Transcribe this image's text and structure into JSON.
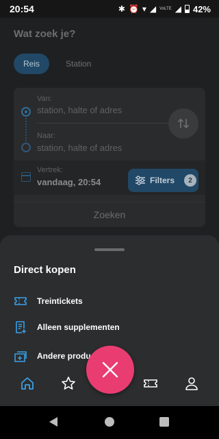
{
  "status_bar": {
    "time": "20:54",
    "volte": "VoLTE",
    "battery": "42%"
  },
  "planner": {
    "title": "Wat zoek je?",
    "tabs": [
      {
        "label": "Reis",
        "active": true
      },
      {
        "label": "Station",
        "active": false
      }
    ],
    "from_label": "Van:",
    "from_placeholder": "station, halte of adres",
    "to_label": "Naar:",
    "to_placeholder": "station, halte of adres",
    "depart_label": "Vertrek:",
    "depart_value": "vandaag, 20:54",
    "filters_label": "Filters",
    "filters_count": "2",
    "search_label": "Zoeken"
  },
  "sheet": {
    "title": "Direct kopen",
    "options": [
      {
        "label": "Treintickets",
        "icon": "ticket-icon"
      },
      {
        "label": "Alleen supplementen",
        "icon": "receipt-plus-icon"
      },
      {
        "label": "Andere producten",
        "icon": "add-product-icon"
      }
    ]
  },
  "bottom_nav": {
    "items": [
      "home-icon",
      "star-icon",
      "close-icon",
      "ticket-icon",
      "profile-icon"
    ]
  },
  "colors": {
    "accent": "#2d6e9c",
    "fab": "#e93d72",
    "icon_blue": "#3aa0e6"
  }
}
